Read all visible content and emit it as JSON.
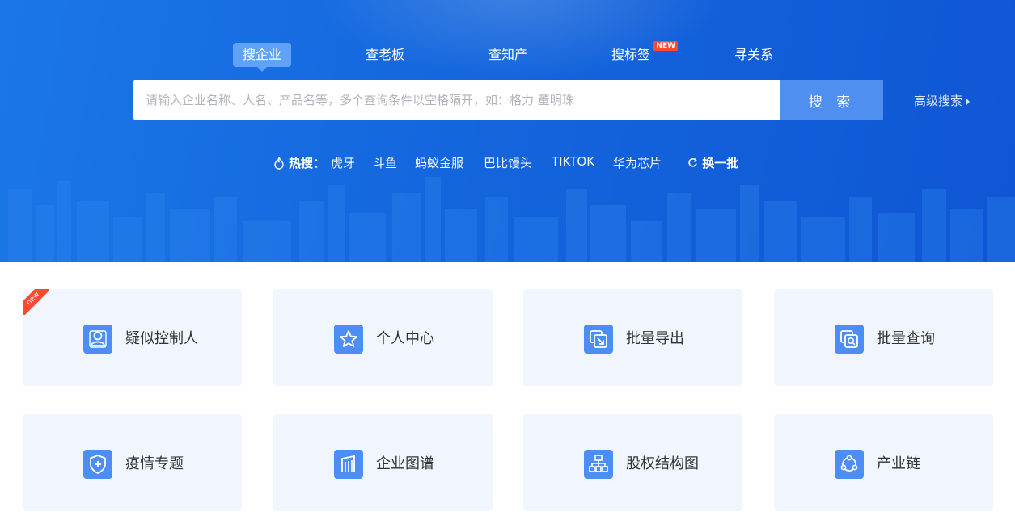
{
  "tabs": [
    {
      "label": "搜企业",
      "active": true
    },
    {
      "label": "查老板",
      "active": false
    },
    {
      "label": "查知产",
      "active": false
    },
    {
      "label": "搜标签",
      "active": false,
      "badge": "NEW"
    },
    {
      "label": "寻关系",
      "active": false
    }
  ],
  "search": {
    "placeholder": "请输入企业名称、人名、产品名等，多个查询条件以空格隔开，如：格力 董明珠",
    "value": "",
    "button_label": "搜 索",
    "advanced_label": "高级搜索"
  },
  "hot": {
    "icon": "fire-icon",
    "label": "热搜：",
    "items": [
      "虎牙",
      "斗鱼",
      "蚂蚁金服",
      "巴比馒头",
      "TIKTOK",
      "华为芯片"
    ],
    "refresh_icon": "refresh-icon",
    "refresh_label": "换一批"
  },
  "features": [
    {
      "label": "疑似控制人",
      "icon": "person-icon",
      "ribbon": "new"
    },
    {
      "label": "个人中心",
      "icon": "star-icon"
    },
    {
      "label": "批量导出",
      "icon": "export-icon"
    },
    {
      "label": "批量查询",
      "icon": "batch-search-icon"
    },
    {
      "label": "疫情专题",
      "icon": "shield-plus-icon"
    },
    {
      "label": "企业图谱",
      "icon": "building-icon"
    },
    {
      "label": "股权结构图",
      "icon": "org-chart-icon"
    },
    {
      "label": "产业链",
      "icon": "cycle-icon"
    }
  ],
  "colors": {
    "hero_start": "#1b77e6",
    "hero_end": "#0f56d4",
    "active_tab": "#5fa2f7",
    "search_button": "#4f8ff0",
    "badge": "#ff4a2f",
    "card_bg": "#f1f6fe",
    "icon_bg": "#4c8ef5"
  }
}
